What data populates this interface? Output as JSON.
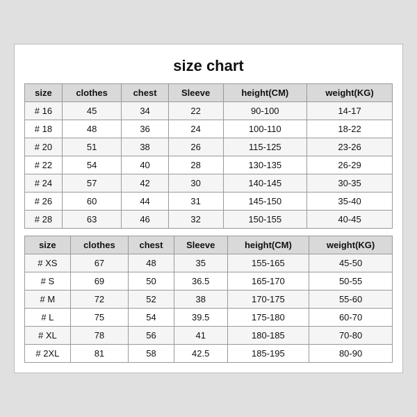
{
  "title": "size chart",
  "table1": {
    "headers": [
      "size",
      "clothes",
      "chest",
      "Sleeve",
      "height(CM)",
      "weight(KG)"
    ],
    "rows": [
      [
        "# 16",
        "45",
        "34",
        "22",
        "90-100",
        "14-17"
      ],
      [
        "# 18",
        "48",
        "36",
        "24",
        "100-110",
        "18-22"
      ],
      [
        "# 20",
        "51",
        "38",
        "26",
        "115-125",
        "23-26"
      ],
      [
        "# 22",
        "54",
        "40",
        "28",
        "130-135",
        "26-29"
      ],
      [
        "# 24",
        "57",
        "42",
        "30",
        "140-145",
        "30-35"
      ],
      [
        "# 26",
        "60",
        "44",
        "31",
        "145-150",
        "35-40"
      ],
      [
        "# 28",
        "63",
        "46",
        "32",
        "150-155",
        "40-45"
      ]
    ]
  },
  "table2": {
    "headers": [
      "size",
      "clothes",
      "chest",
      "Sleeve",
      "height(CM)",
      "weight(KG)"
    ],
    "rows": [
      [
        "# XS",
        "67",
        "48",
        "35",
        "155-165",
        "45-50"
      ],
      [
        "# S",
        "69",
        "50",
        "36.5",
        "165-170",
        "50-55"
      ],
      [
        "# M",
        "72",
        "52",
        "38",
        "170-175",
        "55-60"
      ],
      [
        "# L",
        "75",
        "54",
        "39.5",
        "175-180",
        "60-70"
      ],
      [
        "# XL",
        "78",
        "56",
        "41",
        "180-185",
        "70-80"
      ],
      [
        "# 2XL",
        "81",
        "58",
        "42.5",
        "185-195",
        "80-90"
      ]
    ]
  }
}
